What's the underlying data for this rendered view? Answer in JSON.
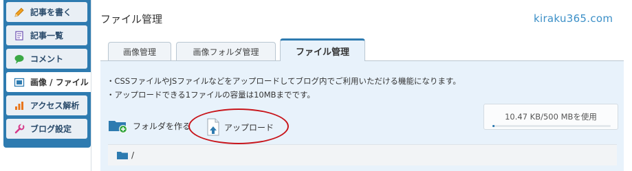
{
  "sidebar": {
    "items": [
      {
        "label": "記事を書く",
        "icon": "pencil-icon"
      },
      {
        "label": "記事一覧",
        "icon": "document-list-icon"
      },
      {
        "label": "コメント",
        "icon": "speech-bubble-icon"
      },
      {
        "label": "画像 / ファイル",
        "icon": "image-file-icon",
        "active": true
      },
      {
        "label": "アクセス解析",
        "icon": "bar-chart-icon"
      },
      {
        "label": "ブログ設定",
        "icon": "wrench-icon"
      }
    ]
  },
  "header": {
    "title": "ファイル管理",
    "brand": "kiraku365.com"
  },
  "tabs": [
    {
      "label": "画像管理"
    },
    {
      "label": "画像フォルダ管理"
    },
    {
      "label": "ファイル管理",
      "active": true
    }
  ],
  "description": {
    "line1": "・CSSファイルやJSファイルなどをアップロードしてブログ内でご利用いただける機能になります。",
    "line2": "・アップロードできる1ファイルの容量は10MBまでです。"
  },
  "usage": {
    "text": "10.47 KB/500 MBを使用",
    "fraction": 0.02
  },
  "actions": {
    "new_folder_label": "フォルダを作る",
    "upload_label": "アップロード"
  },
  "path": {
    "current": "/"
  },
  "colors": {
    "accent": "#2e7bb0",
    "highlight": "#c8151b",
    "brand": "#3b8fc7"
  }
}
